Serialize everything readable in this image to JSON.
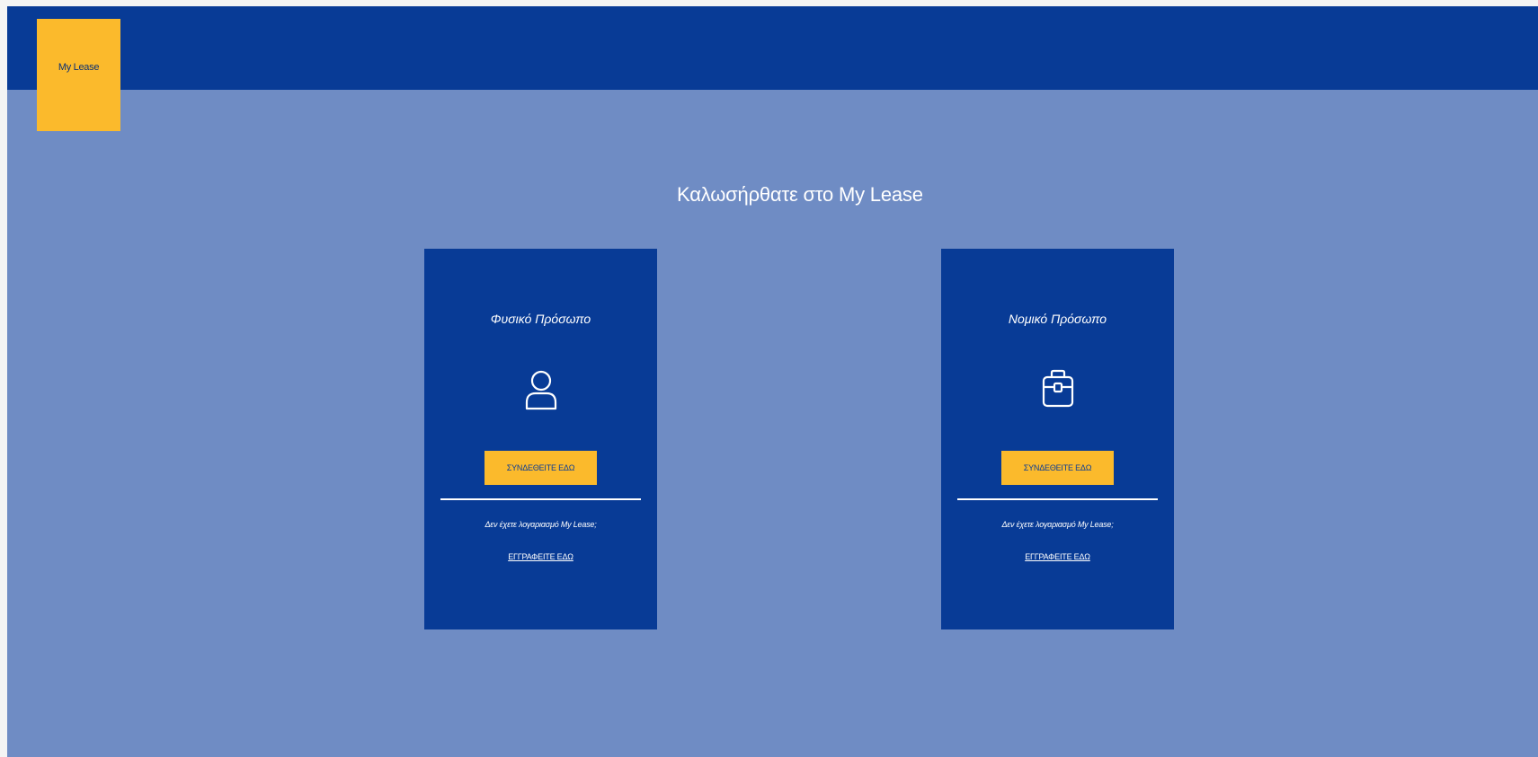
{
  "header": {
    "logo_text": "My Lease"
  },
  "welcome": {
    "title": "Καλωσήρθατε στο My Lease"
  },
  "cards": [
    {
      "title": "Φυσικό Πρόσωπο",
      "icon": "person-icon",
      "login_label": "ΣΥΝΔΕΘΕΙΤΕ ΕΔΩ",
      "no_account_text": "Δεν έχετε λογαριασμό My Lease;",
      "register_label": "ΕΓΓΡΑΦΕΙΤΕ ΕΔΩ"
    },
    {
      "title": "Νομικό Πρόσωπο",
      "icon": "briefcase-icon",
      "login_label": "ΣΥΝΔΕΘΕΙΤΕ ΕΔΩ",
      "no_account_text": "Δεν έχετε λογαριασμό My Lease;",
      "register_label": "ΕΓΓΡΑΦΕΙΤΕ ΕΔΩ"
    }
  ],
  "colors": {
    "header_bg": "#083b96",
    "page_bg": "#6f8cc4",
    "card_bg": "#083b96",
    "accent": "#fbba2c"
  }
}
